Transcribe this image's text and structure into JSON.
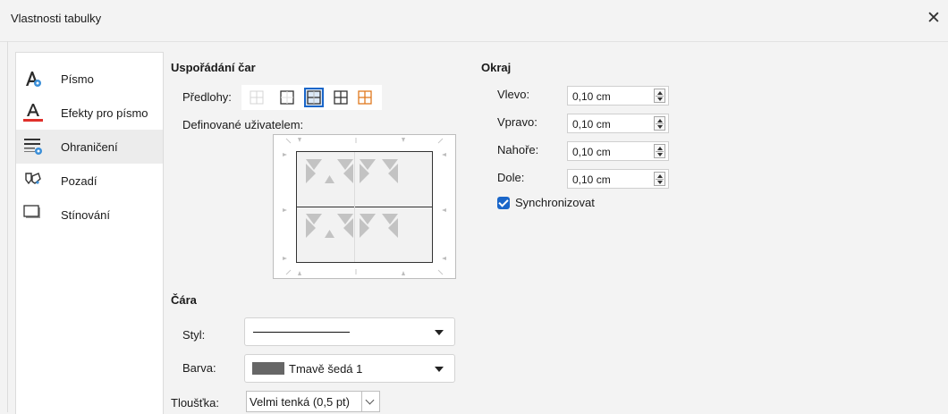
{
  "dialog": {
    "title": "Vlastnosti tabulky",
    "close_glyph": "✕"
  },
  "sidebar": {
    "items": [
      {
        "label": "Písmo",
        "icon": "font-icon",
        "selected": false
      },
      {
        "label": "Efekty pro písmo",
        "icon": "font-effects-icon",
        "selected": false
      },
      {
        "label": "Ohraničení",
        "icon": "borders-icon",
        "selected": true
      },
      {
        "label": "Pozadí",
        "icon": "background-icon",
        "selected": false
      },
      {
        "label": "Stínování",
        "icon": "shadow-icon",
        "selected": false
      }
    ]
  },
  "line_arrangement": {
    "title": "Uspořádání čar",
    "presets_label": "Předlohy:",
    "presets": [
      "no-borders",
      "outer-border",
      "outer-and-horizontal",
      "outer-and-all-inner",
      "outer-no-inner"
    ],
    "selected_preset": 2,
    "user_defined_label": "Definované uživatelem:"
  },
  "padding": {
    "title": "Okraj",
    "fields": [
      {
        "label": "Vlevo:",
        "value": "0,10 cm"
      },
      {
        "label": "Vpravo:",
        "value": "0,10 cm"
      },
      {
        "label": "Nahoře:",
        "value": "0,10 cm"
      },
      {
        "label": "Dole:",
        "value": "0,10 cm"
      }
    ],
    "synchronize_label": "Synchronizovat",
    "synchronize_checked": true
  },
  "line": {
    "title": "Čára",
    "style_label": "Styl:",
    "color_label": "Barva:",
    "color_value": "Tmavě šedá 1",
    "color_swatch": "#666666",
    "thickness_label": "Tloušťka:",
    "thickness_value": "Velmi tenká (0,5 pt)"
  },
  "colors": {
    "accent": "#1a66c9",
    "preset_orange": "#e07a1f",
    "font_effect_red": "#e0302a"
  }
}
